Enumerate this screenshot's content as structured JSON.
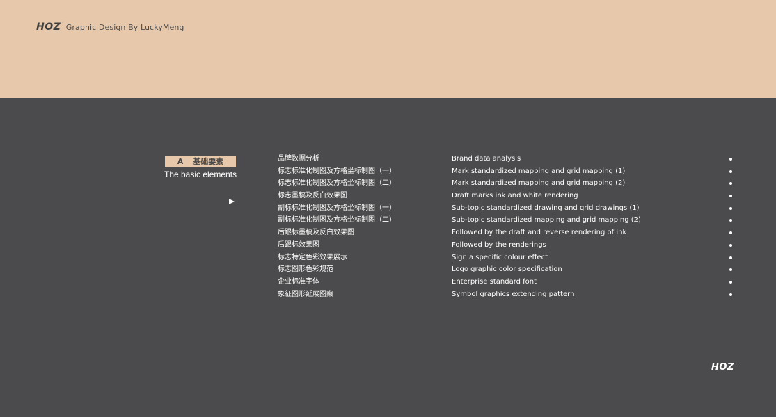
{
  "header": {
    "logo": "HOZ",
    "logo_mark": "´",
    "tagline": "Graphic Design By LuckyMeng"
  },
  "section": {
    "letter": "A",
    "title_cn": "基础要素",
    "title_en": "The basic elements"
  },
  "toc": [
    {
      "cn": "品牌数据分析",
      "en": "Brand data analysis"
    },
    {
      "cn": "标志标准化制图及方格坐标制图（一）",
      "en": "Mark standardized mapping and grid mapping (1)"
    },
    {
      "cn": "标志标准化制图及方格坐标制图（二）",
      "en": "Mark standardized mapping and grid mapping (2)"
    },
    {
      "cn": "标志墨稿及反白效果图",
      "en": "Draft marks ink and white rendering"
    },
    {
      "cn": "副标标准化制图及方格坐标制图（一）",
      "en": "Sub-topic standardized drawing and grid drawings (1)"
    },
    {
      "cn": "副标标准化制图及方格坐标制图（二）",
      "en": "Sub-topic standardized mapping and grid mapping (2)"
    },
    {
      "cn": "后跟标墨稿及反白效果图",
      "en": "Followed by the draft and reverse rendering of ink"
    },
    {
      "cn": "后跟标效果图",
      "en": "Followed by the renderings"
    },
    {
      "cn": "标志特定色彩效果展示",
      "en": "Sign a specific colour effect"
    },
    {
      "cn": "标志图形色彩规范",
      "en": "Logo graphic color specification"
    },
    {
      "cn": "企业标准字体",
      "en": "Enterprise standard font"
    },
    {
      "cn": "象征图形延展图案",
      "en": "Symbol graphics extending pattern"
    }
  ],
  "footer": {
    "logo": "HOZ",
    "logo_mark": "´"
  },
  "colors": {
    "accent": "#e8c8aa",
    "background": "#4b4b4d",
    "text_dark": "#4a4a4a",
    "text_light": "#ffffff"
  },
  "icons": {
    "play": "play-icon",
    "bullet": "bullet-dot-icon"
  }
}
